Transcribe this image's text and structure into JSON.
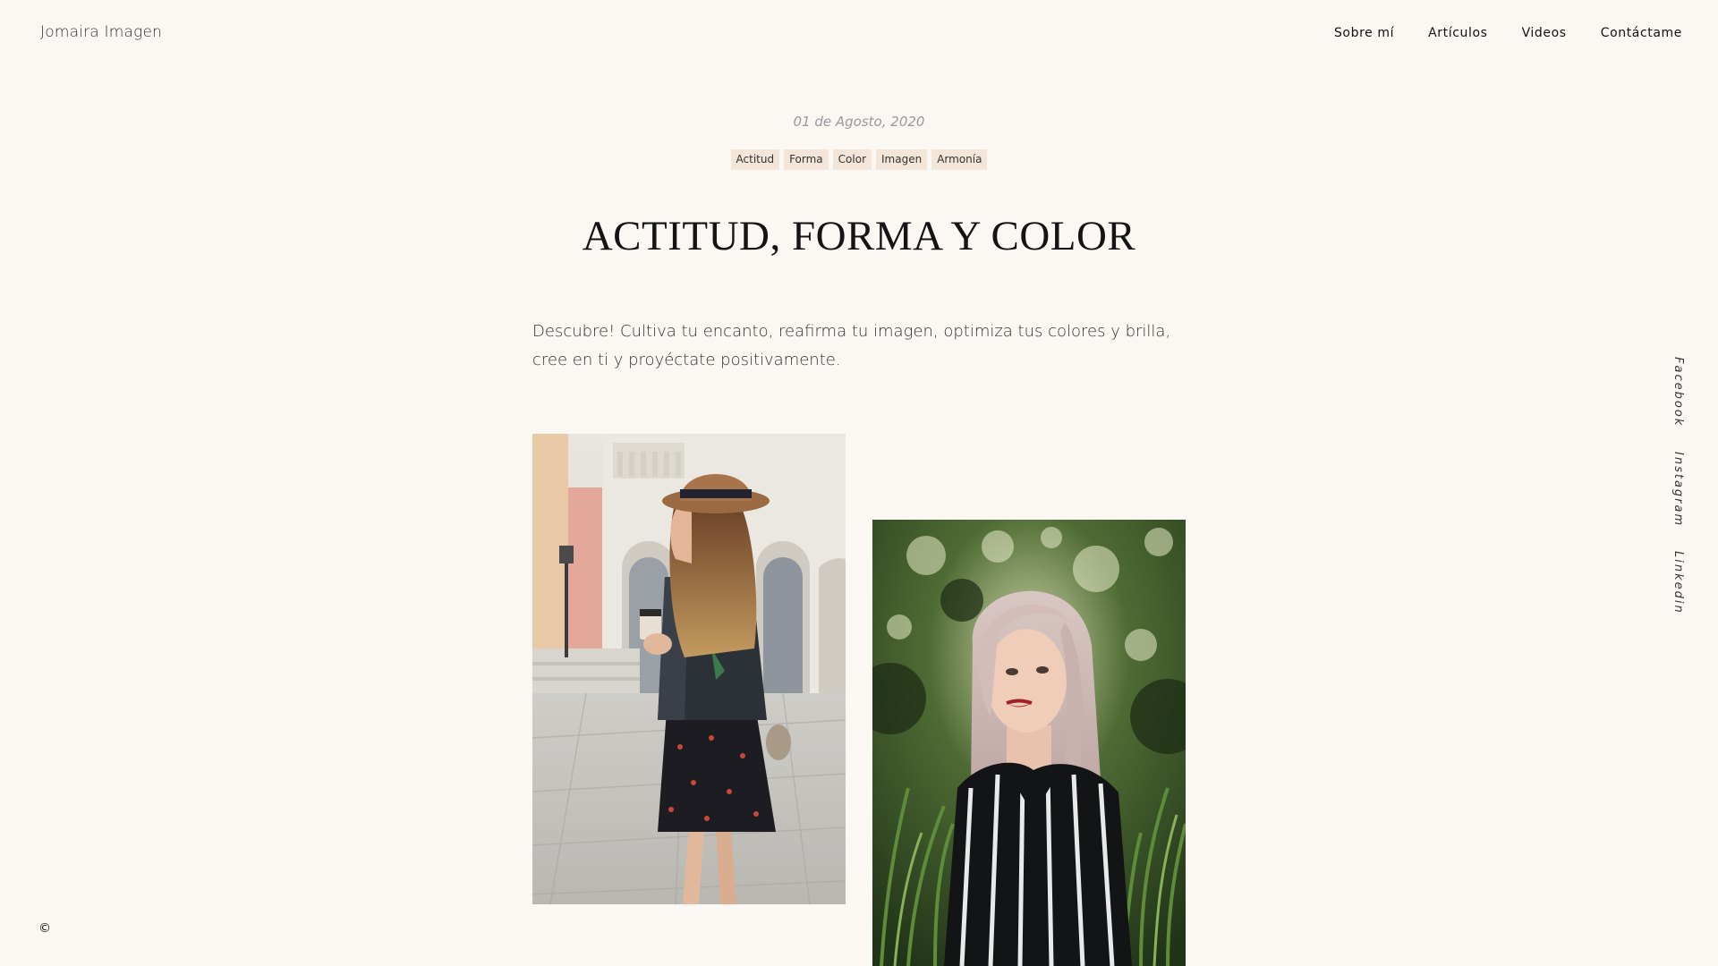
{
  "header": {
    "brand": "Jomaira Imagen",
    "nav": [
      "Sobre mí",
      "Artículos",
      "Videos",
      "Contáctame"
    ]
  },
  "article": {
    "date": "01 de Agosto, 2020",
    "tags": [
      "Actitud",
      "Forma",
      "Color",
      "Imagen",
      "Armonía"
    ],
    "title": "ACTITUD, FORMA Y COLOR",
    "intro": "Descubre! Cultiva tu encanto, reafirma tu imagen, optimiza tus colores y brilla, cree en ti y proyéctate positivamente."
  },
  "social": [
    "Facebook",
    "Instagram",
    "Linkedin"
  ],
  "footer": {
    "copyright": "©"
  },
  "colors": {
    "background": "#fbf7f2",
    "tag_background": "#f3e6d8",
    "title": "#141414",
    "date": "#9a9a9a"
  }
}
